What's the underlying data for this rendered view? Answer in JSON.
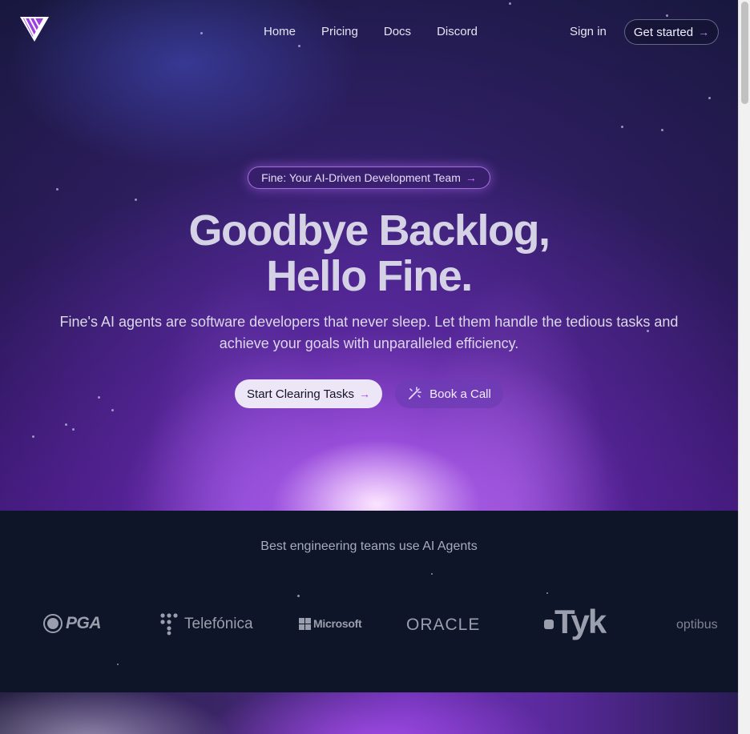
{
  "nav": {
    "links": [
      "Home",
      "Pricing",
      "Docs",
      "Discord"
    ],
    "sign_in": "Sign in",
    "get_started": "Get started",
    "arrow": "→"
  },
  "hero": {
    "badge": "Fine: Your AI-Driven Development Team",
    "headline_line1": "Goodbye Backlog,",
    "headline_line2": "Hello Fine.",
    "subtitle": "Fine's AI agents are software developers that never sleep. Let them handle the tedious tasks and achieve your goals with unparalleled efficiency.",
    "primary_cta": "Start Clearing Tasks",
    "secondary_cta": "Book a Call"
  },
  "logos": {
    "title": "Best engineering teams use AI Agents",
    "items": [
      "PGA",
      "Telefónica",
      "Microsoft",
      "ORACLE",
      "Tyk",
      "optibus"
    ]
  },
  "colors": {
    "accent": "#c77dff",
    "background": "#0e1528",
    "button_primary": "#ece6f7"
  }
}
